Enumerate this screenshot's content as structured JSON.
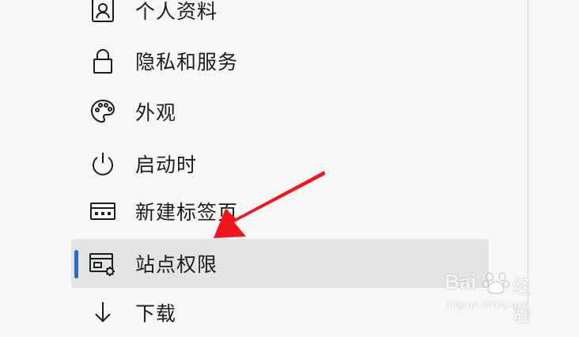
{
  "nav": {
    "items": [
      {
        "label": "个人资料",
        "icon": "profile-icon"
      },
      {
        "label": "隐私和服务",
        "icon": "lock-icon"
      },
      {
        "label": "外观",
        "icon": "palette-icon"
      },
      {
        "label": "启动时",
        "icon": "power-icon"
      },
      {
        "label": "新建标签页",
        "icon": "new-tab-icon"
      },
      {
        "label": "站点权限",
        "icon": "site-permissions-icon",
        "selected": true
      },
      {
        "label": "下载",
        "icon": "download-icon"
      }
    ]
  },
  "colors": {
    "selection_indicator": "#2a6acb",
    "selected_background": "#e4e4e4",
    "annotation_arrow": "#f2161c"
  },
  "watermark": {
    "brand": "Bai",
    "cn": "经验",
    "url": "jingyan.baidu.com"
  }
}
